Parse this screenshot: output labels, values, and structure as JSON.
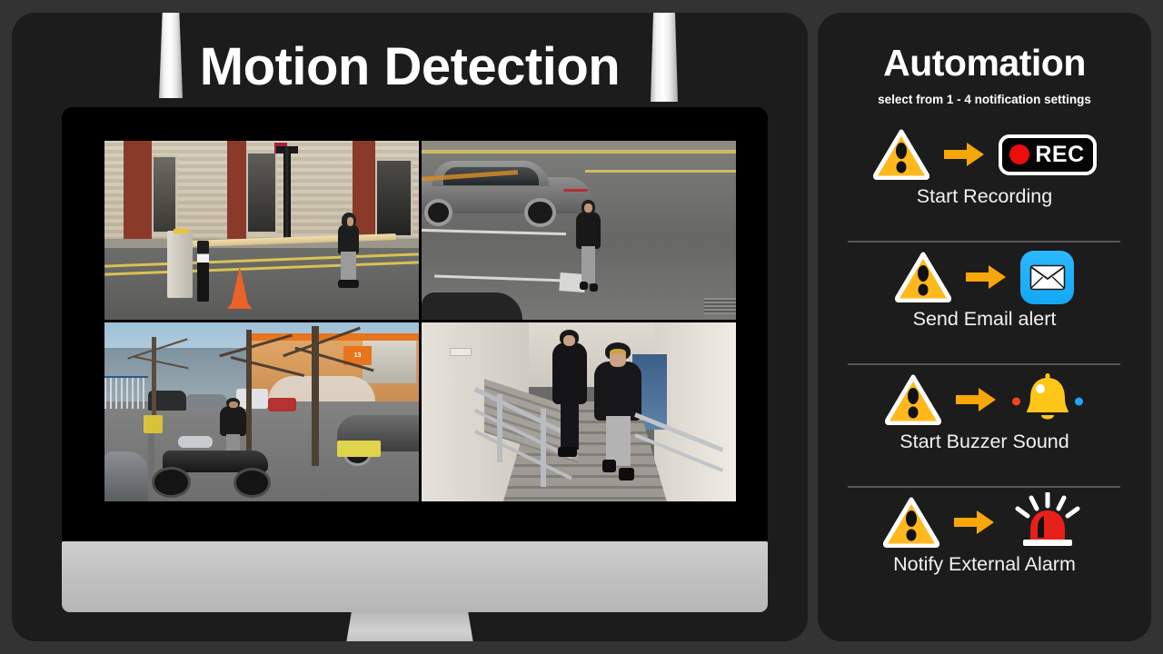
{
  "left": {
    "title": "Motion Detection",
    "monitor": {
      "cameras": [
        {
          "name": "cam-1",
          "scene": "street with security barrier, traffic cone and a hooded person walking past a brick building"
        },
        {
          "name": "cam-2",
          "scene": "car park with a grey sports car and a hooded person standing on the tarmac"
        },
        {
          "name": "cam-3",
          "scene": "industrial estate car park with bare trees, parked motorcycle and a person in a dark jacket"
        },
        {
          "name": "cam-4",
          "scene": "indoor stairwell with two hooded people climbing the stairs"
        }
      ],
      "cam3_building_number": "13"
    }
  },
  "right": {
    "title": "Automation",
    "subtitle": "select from 1 - 4 notification settings",
    "rows": [
      {
        "label": "Start Recording",
        "trigger_icon": "warning-triangle-icon",
        "arrow_icon": "arrow-right-icon",
        "action_icon": "rec-badge-icon"
      },
      {
        "label": "Send Email alert",
        "trigger_icon": "warning-triangle-icon",
        "arrow_icon": "arrow-right-icon",
        "action_icon": "email-envelope-icon"
      },
      {
        "label": "Start Buzzer Sound",
        "trigger_icon": "warning-triangle-icon",
        "arrow_icon": "arrow-right-icon",
        "action_icon": "bell-icon"
      },
      {
        "label": "Notify External Alarm",
        "trigger_icon": "warning-triangle-icon",
        "arrow_icon": "arrow-right-icon",
        "action_icon": "siren-light-icon"
      }
    ],
    "rec_badge": {
      "text": "REC"
    }
  },
  "colors": {
    "background": "#333333",
    "panel": "#1c1c1c",
    "warning_amber": "#ffb81c",
    "arrow_orange": "#f7a70a",
    "rec_red": "#ec0d0d",
    "email_blue": "#1cb0f6",
    "bell_yellow": "#ffc61a",
    "siren_red": "#e8201c",
    "text_white": "#ffffff",
    "divider_gray": "#585858"
  }
}
